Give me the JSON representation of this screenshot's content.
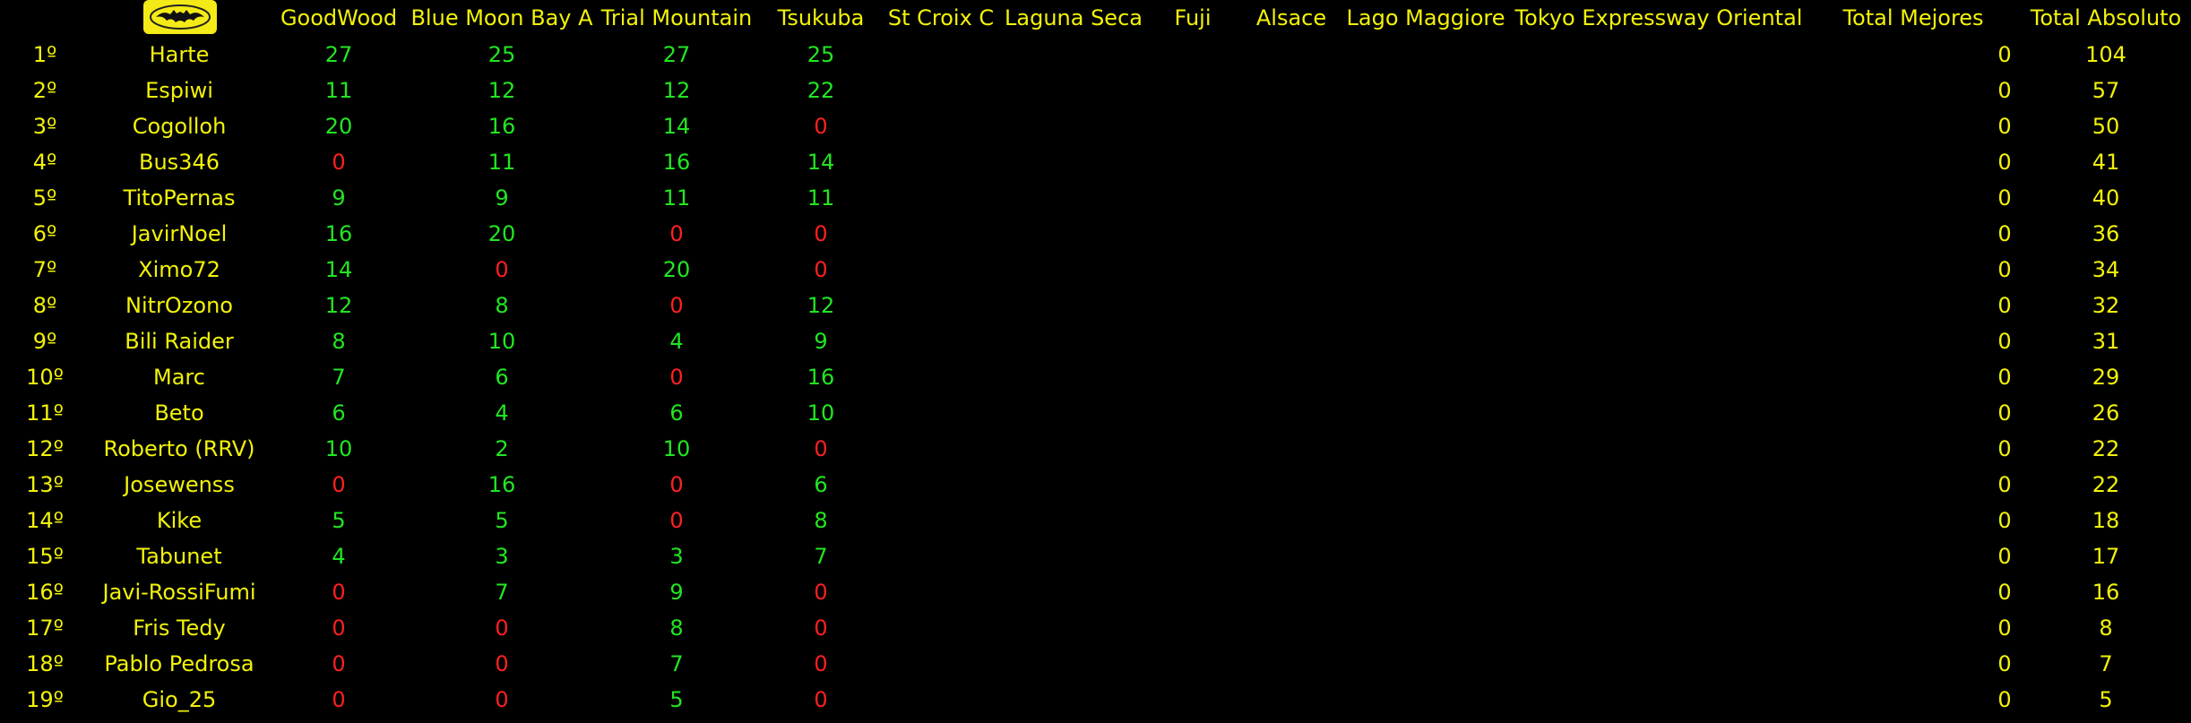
{
  "logo": "bat-logo-icon",
  "headers": [
    "GoodWood",
    "Blue Moon Bay A",
    "Trial Mountain",
    "Tsukuba",
    "St Croix C",
    "Laguna Seca",
    "Fuji",
    "Alsace",
    "Lago Maggiore",
    "Tokyo Expressway Oriental",
    "Total Mejores",
    "Total Absoluto"
  ],
  "colors": {
    "positive": "#22e622",
    "zero": "#ff2020",
    "text": "#f2f20a",
    "background": "#000000"
  },
  "rows": [
    {
      "pos": "1º",
      "name": "Harte",
      "scores": [
        27,
        25,
        27,
        25
      ],
      "mejores": 0,
      "total": 104
    },
    {
      "pos": "2º",
      "name": "Espiwi",
      "scores": [
        11,
        12,
        12,
        22
      ],
      "mejores": 0,
      "total": 57
    },
    {
      "pos": "3º",
      "name": "Cogolloh",
      "scores": [
        20,
        16,
        14,
        0
      ],
      "mejores": 0,
      "total": 50
    },
    {
      "pos": "4º",
      "name": "Bus346",
      "scores": [
        0,
        11,
        16,
        14
      ],
      "mejores": 0,
      "total": 41
    },
    {
      "pos": "5º",
      "name": "TitoPernas",
      "scores": [
        9,
        9,
        11,
        11
      ],
      "mejores": 0,
      "total": 40
    },
    {
      "pos": "6º",
      "name": "JavirNoel",
      "scores": [
        16,
        20,
        0,
        0
      ],
      "mejores": 0,
      "total": 36
    },
    {
      "pos": "7º",
      "name": "Ximo72",
      "scores": [
        14,
        0,
        20,
        0
      ],
      "mejores": 0,
      "total": 34
    },
    {
      "pos": "8º",
      "name": "NitrOzono",
      "scores": [
        12,
        8,
        0,
        12
      ],
      "mejores": 0,
      "total": 32
    },
    {
      "pos": "9º",
      "name": "Bili Raider",
      "scores": [
        8,
        10,
        4,
        9
      ],
      "mejores": 0,
      "total": 31
    },
    {
      "pos": "10º",
      "name": "Marc",
      "scores": [
        7,
        6,
        0,
        16
      ],
      "mejores": 0,
      "total": 29
    },
    {
      "pos": "11º",
      "name": "Beto",
      "scores": [
        6,
        4,
        6,
        10
      ],
      "mejores": 0,
      "total": 26
    },
    {
      "pos": "12º",
      "name": "Roberto (RRV)",
      "scores": [
        10,
        2,
        10,
        0
      ],
      "mejores": 0,
      "total": 22
    },
    {
      "pos": "13º",
      "name": "Josewenss",
      "scores": [
        0,
        16,
        0,
        6
      ],
      "mejores": 0,
      "total": 22
    },
    {
      "pos": "14º",
      "name": "Kike",
      "scores": [
        5,
        5,
        0,
        8
      ],
      "mejores": 0,
      "total": 18
    },
    {
      "pos": "15º",
      "name": "Tabunet",
      "scores": [
        4,
        3,
        3,
        7
      ],
      "mejores": 0,
      "total": 17
    },
    {
      "pos": "16º",
      "name": "Javi-RossiFumi",
      "scores": [
        0,
        7,
        9,
        0
      ],
      "mejores": 0,
      "total": 16
    },
    {
      "pos": "17º",
      "name": "Fris Tedy",
      "scores": [
        0,
        0,
        8,
        0
      ],
      "mejores": 0,
      "total": 8
    },
    {
      "pos": "18º",
      "name": "Pablo Pedrosa",
      "scores": [
        0,
        0,
        7,
        0
      ],
      "mejores": 0,
      "total": 7
    },
    {
      "pos": "19º",
      "name": "Gio_25",
      "scores": [
        0,
        0,
        5,
        0
      ],
      "mejores": 0,
      "total": 5
    }
  ]
}
